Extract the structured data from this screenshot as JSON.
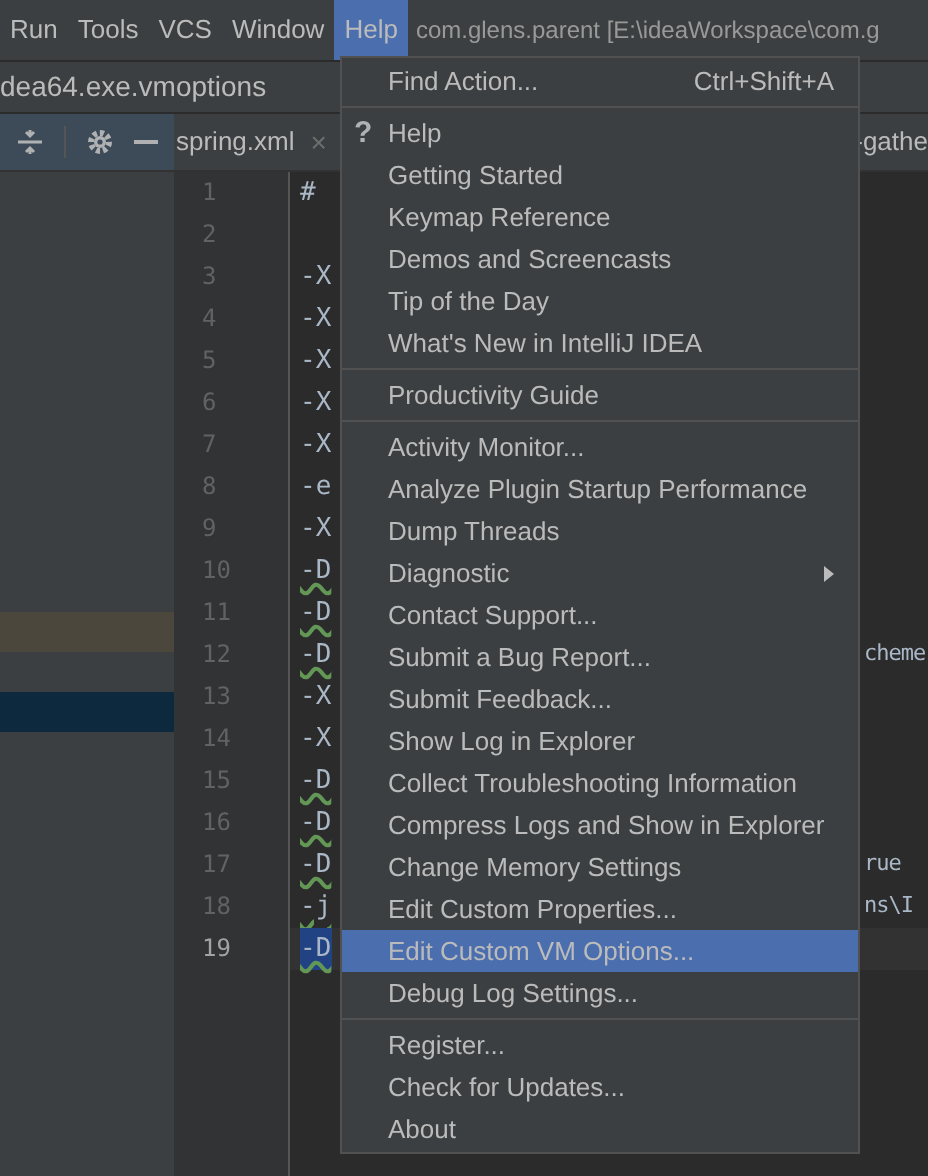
{
  "menu_bar": {
    "items": [
      {
        "label": "Run",
        "selected": false
      },
      {
        "label": "Tools",
        "selected": false
      },
      {
        "label": "VCS",
        "selected": false
      },
      {
        "label": "Window",
        "selected": false
      },
      {
        "label": "Help",
        "selected": true
      }
    ],
    "title": "com.glens.parent [E:\\ideaWorkspace\\com.g"
  },
  "file_path": "dea64.exe.vmoptions",
  "tabs": [
    {
      "label": "spring.xml",
      "close": "×"
    },
    {
      "label": "-gathe"
    }
  ],
  "editor": {
    "lines": [
      {
        "number": "1",
        "text": "#",
        "current": false,
        "warning": false
      },
      {
        "number": "2"
      },
      {
        "number": "3",
        "text": "-X",
        "current": false,
        "warning": false
      },
      {
        "number": "4",
        "text": "-X",
        "current": false,
        "warning": false
      },
      {
        "number": "5",
        "text": "-X",
        "current": false,
        "warning": false
      },
      {
        "number": "6",
        "text": "-X",
        "current": false,
        "warning": false
      },
      {
        "number": "7",
        "text": "-X",
        "current": false,
        "warning": false
      },
      {
        "number": "8",
        "text": "-e",
        "current": false,
        "warning": false
      },
      {
        "number": "9",
        "text": "-X",
        "current": false,
        "warning": false
      },
      {
        "number": "10",
        "text": "-D",
        "current": false,
        "warning": true
      },
      {
        "number": "11",
        "text": "-D",
        "current": false,
        "warning": true
      },
      {
        "number": "12",
        "text": "-D",
        "trailing": "cheme",
        "current": false,
        "warning": true
      },
      {
        "number": "13",
        "text": "-X",
        "current": false,
        "warning": false
      },
      {
        "number": "14",
        "text": "-X",
        "current": false,
        "warning": false
      },
      {
        "number": "15",
        "text": "-D",
        "current": false,
        "warning": true
      },
      {
        "number": "16",
        "text": "-D",
        "current": false,
        "warning": true
      },
      {
        "number": "17",
        "text": "-D",
        "trailing": "rue",
        "current": false,
        "warning": true
      },
      {
        "number": "18",
        "text": "-j",
        "trailing": "ns\\I",
        "current": false,
        "warning": true
      },
      {
        "number": "19",
        "text": "-D",
        "current": true,
        "warning": true
      }
    ]
  },
  "help_menu": {
    "items": [
      {
        "kind": "item",
        "label": "Find Action...",
        "shortcut": "Ctrl+Shift+A",
        "selected": false
      },
      {
        "kind": "separator"
      },
      {
        "kind": "item",
        "label": "Help",
        "icon": "?",
        "selected": false
      },
      {
        "kind": "item",
        "label": "Getting Started",
        "selected": false
      },
      {
        "kind": "item",
        "label": "Keymap Reference",
        "selected": false
      },
      {
        "kind": "item",
        "label": "Demos and Screencasts",
        "selected": false
      },
      {
        "kind": "item",
        "label": "Tip of the Day",
        "selected": false
      },
      {
        "kind": "item",
        "label": "What's New in IntelliJ IDEA",
        "selected": false
      },
      {
        "kind": "separator"
      },
      {
        "kind": "item",
        "label": "Productivity Guide",
        "selected": false
      },
      {
        "kind": "separator"
      },
      {
        "kind": "item",
        "label": "Activity Monitor...",
        "selected": false
      },
      {
        "kind": "item",
        "label": "Analyze Plugin Startup Performance",
        "selected": false
      },
      {
        "kind": "item",
        "label": "Dump Threads",
        "selected": false
      },
      {
        "kind": "item",
        "label": "Diagnostic",
        "submenu": true,
        "selected": false
      },
      {
        "kind": "item",
        "label": "Contact Support...",
        "selected": false
      },
      {
        "kind": "item",
        "label": "Submit a Bug Report...",
        "selected": false
      },
      {
        "kind": "item",
        "label": "Submit Feedback...",
        "selected": false
      },
      {
        "kind": "item",
        "label": "Show Log in Explorer",
        "selected": false
      },
      {
        "kind": "item",
        "label": "Collect Troubleshooting Information",
        "selected": false
      },
      {
        "kind": "item",
        "label": "Compress Logs and Show in Explorer",
        "selected": false
      },
      {
        "kind": "item",
        "label": "Change Memory Settings",
        "selected": false
      },
      {
        "kind": "item",
        "label": "Edit Custom Properties...",
        "selected": false
      },
      {
        "kind": "item",
        "label": "Edit Custom VM Options...",
        "selected": true
      },
      {
        "kind": "item",
        "label": "Debug Log Settings...",
        "selected": false
      },
      {
        "kind": "separator"
      },
      {
        "kind": "item",
        "label": "Register...",
        "selected": false
      },
      {
        "kind": "item",
        "label": "Check for Updates...",
        "selected": false
      },
      {
        "kind": "item",
        "label": "About",
        "selected": false
      }
    ]
  }
}
